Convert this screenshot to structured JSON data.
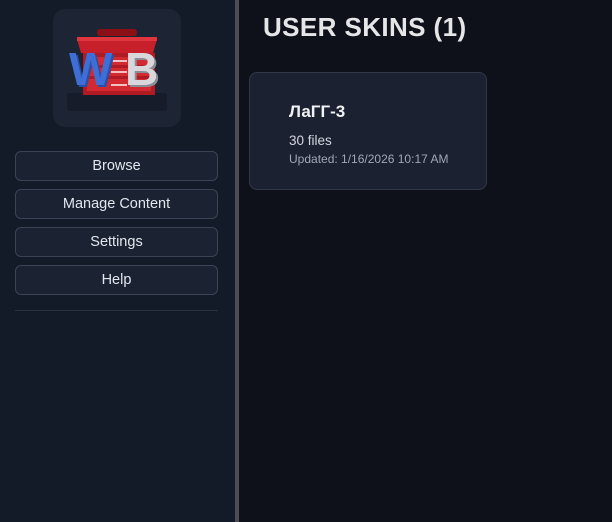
{
  "sidebar": {
    "logo": {
      "text": "WB",
      "letter1": "W",
      "letter2": "B",
      "icon": "red-toolbox-icon",
      "colors": {
        "w": "#3f6fd6",
        "b": "#d8d8dc",
        "toolbox": "#c8202a"
      }
    },
    "nav": [
      {
        "label": "Browse"
      },
      {
        "label": "Manage Content"
      },
      {
        "label": "Settings"
      },
      {
        "label": "Help"
      }
    ]
  },
  "main": {
    "title": "USER SKINS (1)",
    "skins": [
      {
        "name": "ЛаГГ-3",
        "files": "30 files",
        "updated": "Updated: 1/16/2026 10:17 AM"
      }
    ]
  },
  "theme": {
    "background": "#0e1119",
    "sidebar": "#131a28",
    "card": "#1b2130",
    "border": "#3a4456"
  }
}
